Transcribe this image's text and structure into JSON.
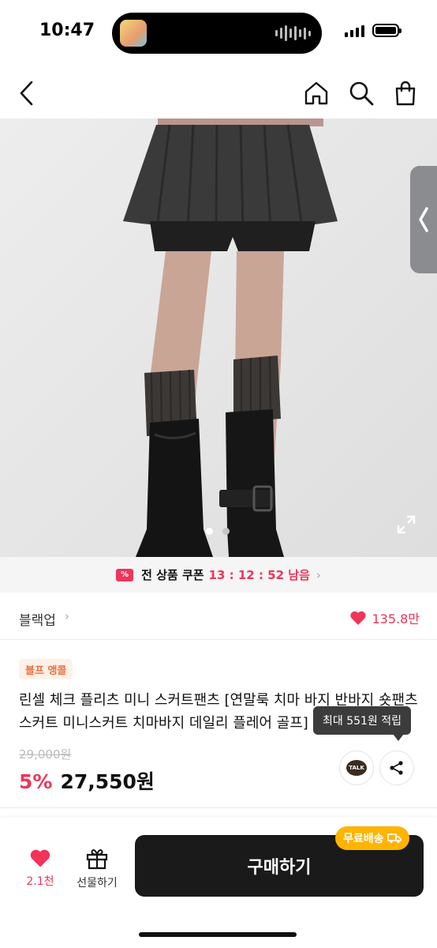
{
  "status_bar": {
    "time": "10:47"
  },
  "nav": {
    "back_icon": "chevron-left-icon",
    "home_icon": "home-icon",
    "search_icon": "search-icon",
    "cart_icon": "shopping-bag-icon"
  },
  "gallery": {
    "current_index": 1,
    "total": 2
  },
  "coupon": {
    "label": "전 상품 쿠폰",
    "timer": "13 : 12 : 52 남음",
    "color": "#f0345a"
  },
  "brand": {
    "name": "블랙업",
    "likes": "135.8만"
  },
  "product": {
    "badge": "블프 앵콜",
    "title": "린셀 체크 플리츠 미니 스커트팬츠 [연말룩 치마 바지 반바지 숏팬츠 스커트 미니스커트 치마바지 데일리 플레어 골프]",
    "original_price": "29,000원",
    "discount": "5%",
    "price": "27,550원"
  },
  "tooltip": {
    "text": "최대 551원 적립"
  },
  "share": {
    "talk_label": "TALK"
  },
  "bottom_bar": {
    "wish_count": "2.1천",
    "gift_label": "선물하기",
    "buy_label": "구매하기",
    "free_shipping_label": "무료배송"
  },
  "colors": {
    "accent": "#f0345a",
    "badge_orange": "#e9713f",
    "shipping_yellow": "#ffb400"
  }
}
